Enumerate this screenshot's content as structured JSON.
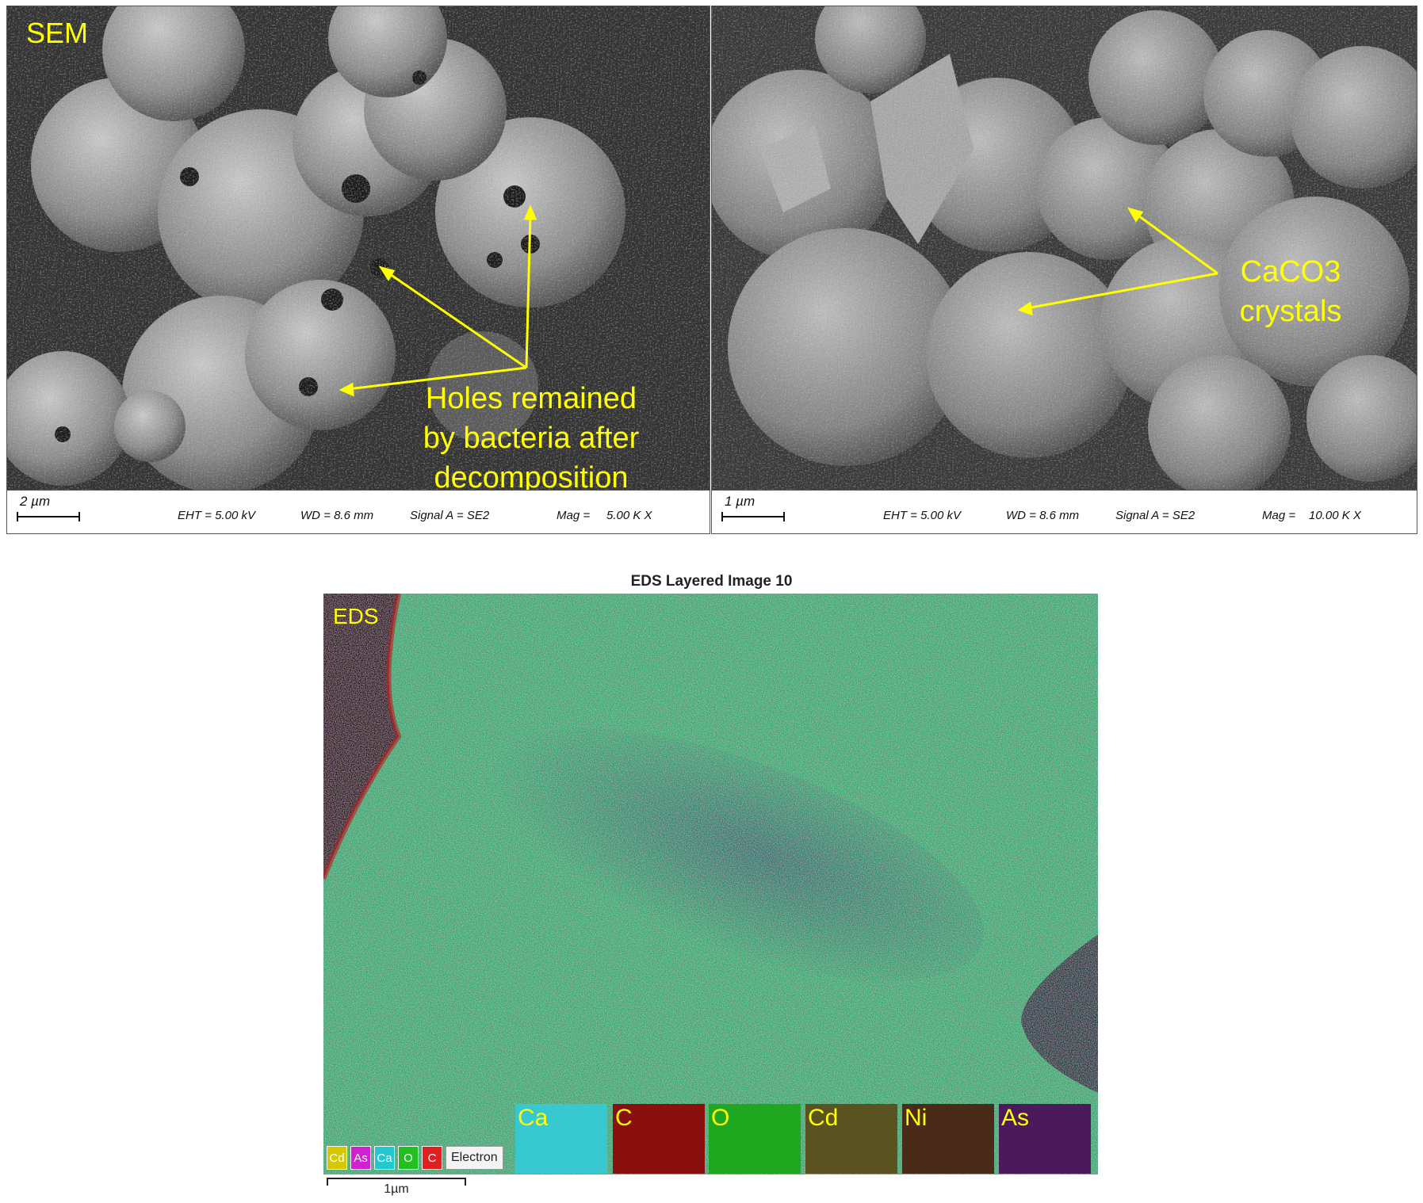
{
  "sem_left": {
    "corner_label": "SEM",
    "annotation_lines": [
      "Holes remained",
      "by bacteria after",
      "decomposition"
    ],
    "scale": "2 µm",
    "eht": "EHT =  5.00 kV",
    "wd": "WD =  8.6 mm",
    "signal": "Signal A = SE2",
    "mag_label": "Mag =",
    "mag_value": "5.00 K X"
  },
  "sem_right": {
    "annotation_lines": [
      "CaCO3",
      "crystals"
    ],
    "scale": "1 µm",
    "eht": "EHT =  5.00 kV",
    "wd": "WD =  8.6 mm",
    "signal": "Signal A = SE2",
    "mag_label": "Mag =",
    "mag_value": "10.00 K X"
  },
  "eds": {
    "title": "EDS Layered Image 10",
    "corner_label": "EDS",
    "legend": [
      {
        "label": "Cd",
        "color": "#d4c800"
      },
      {
        "label": "As",
        "color": "#d020d0"
      },
      {
        "label": "Ca",
        "color": "#20c8d0"
      },
      {
        "label": "O",
        "color": "#20c020"
      },
      {
        "label": "C",
        "color": "#e02020"
      }
    ],
    "legend_electron": "Electron",
    "maps": [
      {
        "label": "Ca",
        "color": "#38c8d0"
      },
      {
        "label": "C",
        "color": "#8a1010"
      },
      {
        "label": "O",
        "color": "#1fa81f"
      },
      {
        "label": "Cd",
        "color": "#5a5220"
      },
      {
        "label": "Ni",
        "color": "#4a2a18"
      },
      {
        "label": "As",
        "color": "#4a1a5a"
      }
    ],
    "scale": "1µm"
  },
  "colors": {
    "annotation": "#ffff00",
    "eds_background": "#2aa870"
  }
}
